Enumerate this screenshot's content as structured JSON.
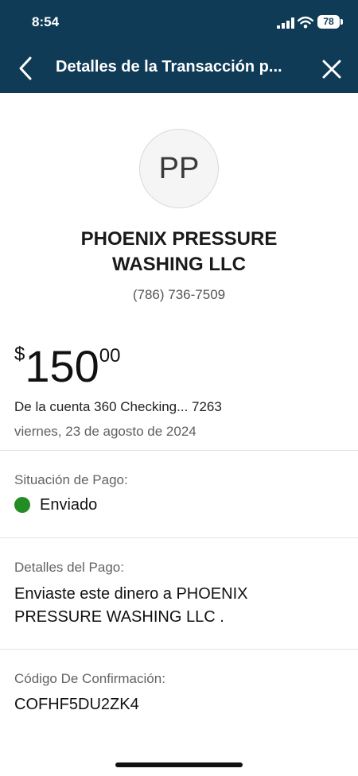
{
  "status_bar": {
    "time": "8:54",
    "battery": "78"
  },
  "header": {
    "title": "Detalles de la Transacción p...",
    "back_icon": "chevron-left-icon",
    "close_icon": "close-icon",
    "background": "#0f3b57"
  },
  "merchant": {
    "initials": "PP",
    "name_line1": "PHOENIX PRESSURE",
    "name_line2": "WASHING LLC",
    "phone": "(786) 736-7509"
  },
  "transaction": {
    "currency_symbol": "$",
    "amount_whole": "150",
    "amount_cents": "00",
    "account": "De la cuenta 360 Checking... 7263",
    "date": "viernes, 23 de agosto de 2024"
  },
  "payment_status": {
    "label": "Situación de Pago:",
    "value": "Enviado",
    "status_color": "#238c24"
  },
  "payment_details": {
    "label": "Detalles del Pago:",
    "line1": "Enviaste este dinero a PHOENIX",
    "line2": "PRESSURE WASHING LLC ."
  },
  "confirmation": {
    "label": "Código De Confirmación:",
    "code": "COFHF5DU2ZK4"
  }
}
